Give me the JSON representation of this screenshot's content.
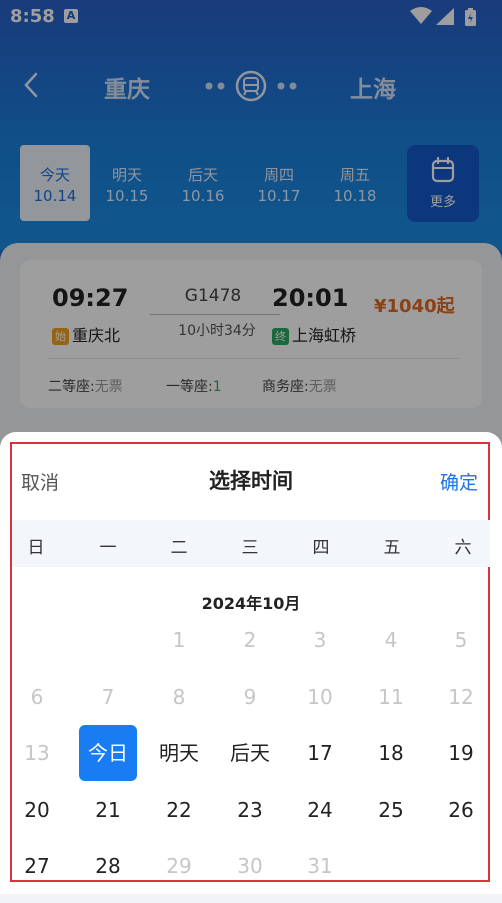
{
  "status": {
    "time": "8:58",
    "notice_icon": "A"
  },
  "route": {
    "from": "重庆",
    "to": "上海"
  },
  "dates": [
    {
      "week": "今天",
      "date": "10.14"
    },
    {
      "week": "明天",
      "date": "10.15"
    },
    {
      "week": "后天",
      "date": "10.16"
    },
    {
      "week": "周四",
      "date": "10.17"
    },
    {
      "week": "周五",
      "date": "10.18"
    }
  ],
  "more_label": "更多",
  "train": {
    "dep_time": "09:27",
    "arr_time": "20:01",
    "number": "G1478",
    "duration": "10小时34分",
    "price": "¥1040起",
    "from_tag": "始",
    "from_station": "重庆北",
    "to_tag": "终",
    "to_station": "上海虹桥",
    "seats": [
      {
        "label": "二等座:",
        "value": "无票"
      },
      {
        "label": "一等座:",
        "value": "1"
      },
      {
        "label": "商务座:",
        "value": "无票"
      }
    ]
  },
  "sheet": {
    "cancel": "取消",
    "title": "选择时间",
    "confirm": "确定",
    "weekdays": [
      "日",
      "一",
      "二",
      "三",
      "四",
      "五",
      "六"
    ],
    "month": "2024年10月",
    "rows": [
      [
        "",
        "",
        "1",
        "2",
        "3",
        "4",
        "5"
      ],
      [
        "6",
        "7",
        "8",
        "9",
        "10",
        "11",
        "12"
      ],
      [
        "13",
        "今日",
        "明天",
        "后天",
        "17",
        "18",
        "19"
      ],
      [
        "20",
        "21",
        "22",
        "23",
        "24",
        "25",
        "26"
      ],
      [
        "27",
        "28",
        "29",
        "30",
        "31",
        "",
        ""
      ]
    ]
  },
  "colors": {
    "accent": "#1a7cf2",
    "price": "#e06a20",
    "frame": "#d9343b"
  }
}
